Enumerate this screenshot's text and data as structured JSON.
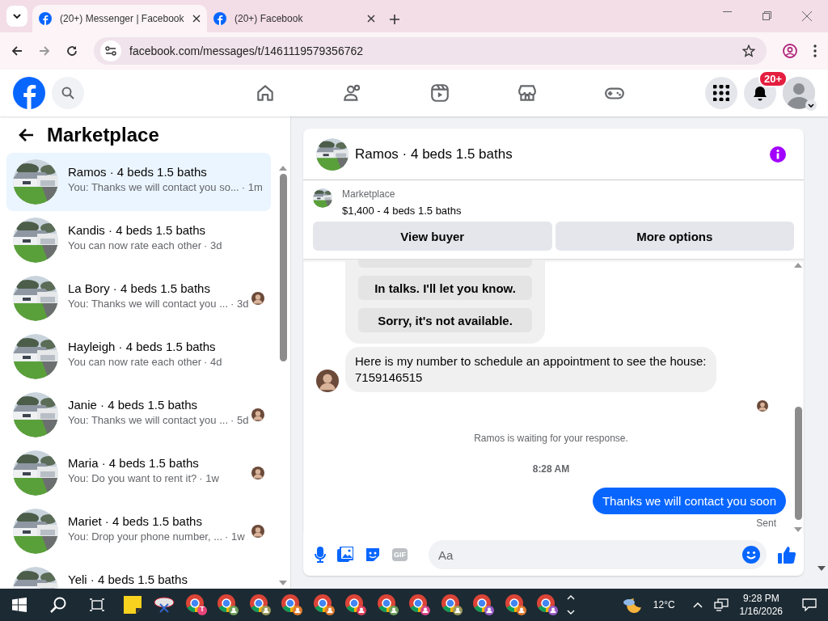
{
  "browser": {
    "tabs": [
      {
        "title": "(20+) Messenger | Facebook",
        "selected": true
      },
      {
        "title": "(20+) Facebook",
        "selected": false
      }
    ],
    "address": "facebook.com/messages/t/1461119579356762"
  },
  "header": {
    "nav": [
      {
        "kind": "home"
      },
      {
        "kind": "friends"
      },
      {
        "kind": "video"
      },
      {
        "kind": "store"
      },
      {
        "kind": "gaming"
      }
    ],
    "notification_badge": "20+"
  },
  "sidebar": {
    "title": "Marketplace",
    "conversations": [
      {
        "title": "Ramos · 4 beds 1.5 baths",
        "preview": "You: Thanks we will contact you so...",
        "time": "· 1m",
        "selected": true,
        "seen": false
      },
      {
        "title": "Kandis · 4 beds 1.5 baths",
        "preview": "You can now rate each other",
        "time": "· 3d",
        "selected": false,
        "seen": false
      },
      {
        "title": "La Bory · 4 beds 1.5 baths",
        "preview": "You: Thanks we will contact you ...",
        "time": "· 3d",
        "selected": false,
        "seen": true
      },
      {
        "title": "Hayleigh · 4 beds 1.5 baths",
        "preview": "You can now rate each other",
        "time": "· 4d",
        "selected": false,
        "seen": false
      },
      {
        "title": "Janie · 4 beds 1.5 baths",
        "preview": "You: Thanks we will contact you ...",
        "time": "· 5d",
        "selected": false,
        "seen": true
      },
      {
        "title": "Maria · 4 beds 1.5 baths",
        "preview": "You: Do you want to rent it?",
        "time": "· 1w",
        "selected": false,
        "seen": true
      },
      {
        "title": "Mariet · 4 beds 1.5 baths",
        "preview": "You: Drop your phone number, ...",
        "time": "· 1w",
        "selected": false,
        "seen": true
      },
      {
        "title": "Yeli · 4 beds 1.5 baths",
        "selected": false,
        "seen": false
      }
    ]
  },
  "chat": {
    "title": "Ramos · 4 beds 1.5 baths",
    "listing": {
      "label": "Marketplace",
      "text": "$1,400 - 4 beds 1.5 baths"
    },
    "buttons": [
      "View buyer",
      "More options"
    ],
    "messages": [
      {
        "kind": "quick_replies",
        "options": [
          "In talks. I'll let you know.",
          "Sorry, it's not available."
        ]
      },
      {
        "kind": "incoming",
        "text": "Here is my number to schedule an appointment to see the house: 7159146515"
      },
      {
        "kind": "seen"
      },
      {
        "kind": "status",
        "text": "Ramos is waiting for your response."
      },
      {
        "kind": "time",
        "text": "8:28 AM"
      },
      {
        "kind": "outgoing",
        "text": "Thanks we will contact you soon"
      },
      {
        "kind": "receipt",
        "text": "Sent"
      }
    ],
    "composer": {
      "gif": "GIF",
      "placeholder": "Aa"
    }
  },
  "taskbar": {
    "apps": [
      {
        "kind": "notes"
      },
      {
        "kind": "snip"
      },
      {
        "kind": "browser",
        "color": "#e8457a",
        "badge": "T"
      },
      {
        "kind": "browser",
        "color": "#6e9e5a"
      },
      {
        "kind": "browser",
        "color": "#9c9a5c"
      },
      {
        "kind": "browser",
        "color": "#e07b2e"
      },
      {
        "kind": "browser",
        "color": "#e07b2e"
      },
      {
        "kind": "browser",
        "color": "#e0405a"
      },
      {
        "kind": "browser",
        "color": "#6e9e5a"
      },
      {
        "kind": "browser",
        "color": "#d9488a"
      },
      {
        "kind": "browser",
        "color": "#9c9a5c"
      },
      {
        "kind": "browser",
        "color": "#9a5cc9"
      },
      {
        "kind": "browser",
        "color": "#e07b2e"
      },
      {
        "kind": "browser",
        "color": "#9a5cc9"
      }
    ],
    "temperature": "12°C",
    "time": "9:28 PM",
    "date": "1/16/2026"
  }
}
